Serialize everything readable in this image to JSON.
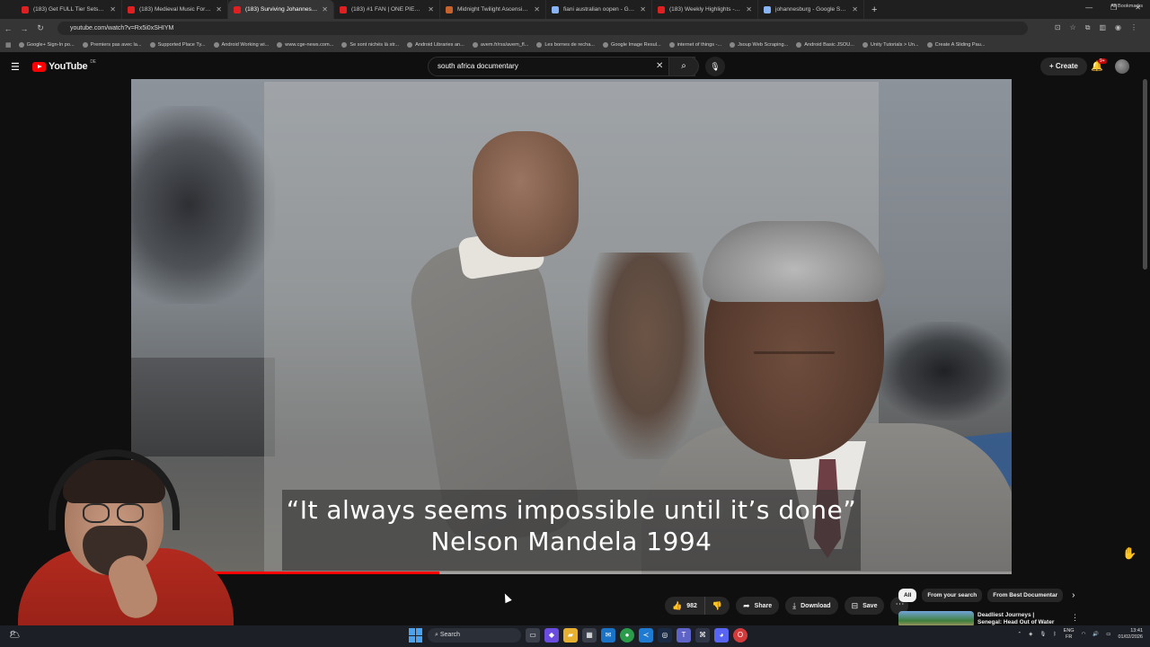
{
  "browser": {
    "tabs": [
      {
        "title": "(183) Get FULL Tier Sets FAST I",
        "fav": "#e02020"
      },
      {
        "title": "(183) Medieval Music For Focus",
        "fav": "#e02020"
      },
      {
        "title": "(183) Surviving Johannesburg",
        "fav": "#e02020",
        "active": true
      },
      {
        "title": "(183) #1 FAN | ONE PIECE | Re",
        "fav": "#e02020"
      },
      {
        "title": "Midnight Twilight Ascension Pa",
        "fav": "#c7622d"
      },
      {
        "title": "fiani australian oopen - Googl",
        "fav": "#8ab4f8"
      },
      {
        "title": "(183) Weekly Highlights - High",
        "fav": "#e02020"
      },
      {
        "title": "johannesburg - Google Search",
        "fav": "#8ab4f8"
      }
    ],
    "url": "youtube.com/watch?v=Rx5i0xSHIYM",
    "bookmarks": [
      "Google+ Sign-In po...",
      "Premiers pas avec la...",
      "Supported Place Ty...",
      "Android Working wi...",
      "www.cge-news.com...",
      "Se sont nichés là str...",
      "Android Libraries an...",
      "avem.fr/rss/avem_fl...",
      "Les bornes de recha...",
      "Google Image Resul...",
      "internet of things -...",
      "Jsoup Web Scraping...",
      "Android Basic JSOU...",
      "Unity Tutorials > Un...",
      "Create A Sliding Pau..."
    ],
    "all_bookmarks": "All Bookmarks"
  },
  "youtube": {
    "logo_text": "YouTube",
    "logo_country": "DE",
    "search_value": "south africa documentary",
    "create_label": "Create",
    "notif_count": "9+"
  },
  "video": {
    "caption_line1": "“It always seems impossible until it’s done”",
    "caption_line2": "Nelson Mandela 1994",
    "progress": 0.35
  },
  "actions": {
    "like_count": "982",
    "share": "Share",
    "download": "Download",
    "save": "Save"
  },
  "chips": [
    "All",
    "From your search",
    "From Best Documentar"
  ],
  "recommendation": {
    "title": "Deadliest Journeys | Senegal: Head Out of Water (Subtitled"
  },
  "taskbar": {
    "search": "Search",
    "lang1": "ENG",
    "lang2": "FR",
    "time": "13:41",
    "date": "01/02/2026"
  }
}
